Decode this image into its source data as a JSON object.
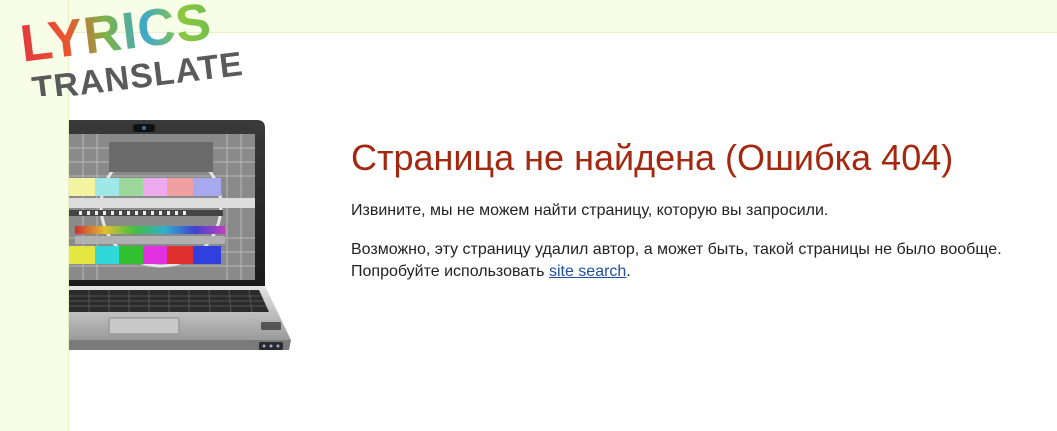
{
  "logo": {
    "line1": "LYRICS",
    "line2": "TRANSLATE"
  },
  "error": {
    "title": "Страница не найдена (Ошибка 404)",
    "message_1": "Извините, мы не можем найти страницу, которую вы запросили.",
    "message_2_before": "Возможно, эту страницу удалил автор, а может быть, такой страницы не было вообще. Попробуйте использовать ",
    "link_label": "site search",
    "message_2_after": "."
  },
  "colors": {
    "title": "#a3280f",
    "link": "#1c4f9e",
    "page_background": "#f7fde6",
    "content_background": "#ffffff"
  }
}
